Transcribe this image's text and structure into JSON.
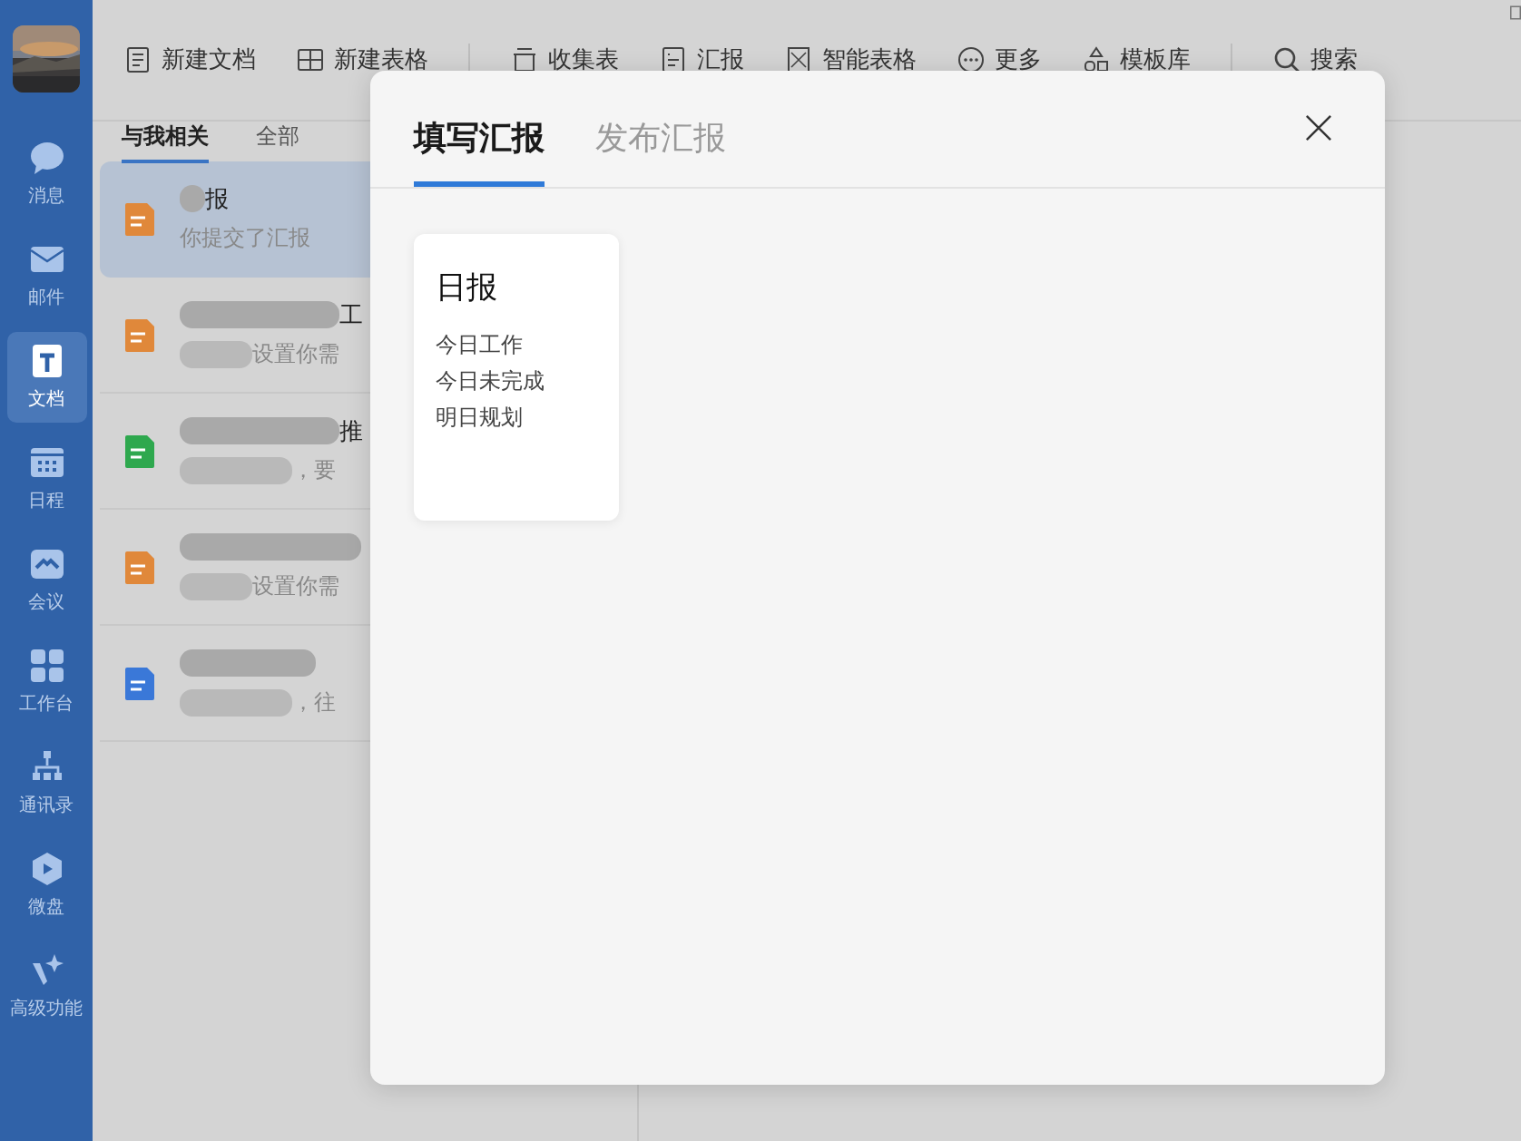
{
  "nav": [
    {
      "label": "消息",
      "selected": false
    },
    {
      "label": "邮件",
      "selected": false
    },
    {
      "label": "文档",
      "selected": true
    },
    {
      "label": "日程",
      "selected": false
    },
    {
      "label": "会议",
      "selected": false
    },
    {
      "label": "工作台",
      "selected": false
    },
    {
      "label": "通讯录",
      "selected": false
    },
    {
      "label": "微盘",
      "selected": false
    },
    {
      "label": "高级功能",
      "selected": false
    }
  ],
  "toolbar_groups": [
    [
      "新建文档",
      "新建表格"
    ],
    [
      "收集表",
      "汇报",
      "智能表格",
      "更多",
      "模板库"
    ],
    [
      "搜索"
    ]
  ],
  "list_tabs": [
    {
      "label": "与我相关",
      "selected": true
    },
    {
      "label": "全部",
      "selected": false
    }
  ],
  "list": [
    {
      "color": "#e0883a",
      "title": "报",
      "subtitle": "你提交了汇报",
      "selected": true
    },
    {
      "color": "#e0883a",
      "title": "工",
      "subtitle": "设置你需",
      "selected": false
    },
    {
      "color": "#2ea84e",
      "title": "推",
      "subtitle": "，要",
      "selected": false
    },
    {
      "color": "#e0883a",
      "subtitle": "设置你需",
      "selected": false
    },
    {
      "color": "#3a78d8",
      "subtitle": "，往",
      "selected": false
    }
  ],
  "dialog": {
    "tabs": [
      {
        "label": "填写汇报",
        "selected": true
      },
      {
        "label": "发布汇报",
        "selected": false
      }
    ],
    "templates": [
      {
        "title": "日报",
        "lines": [
          "今日工作",
          "今日未完成",
          "明日规划"
        ]
      }
    ]
  }
}
